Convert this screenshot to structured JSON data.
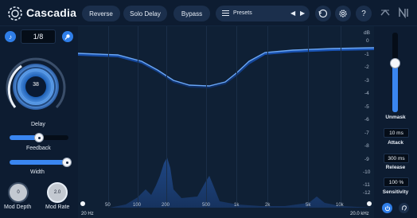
{
  "header": {
    "brand": "Cascadia",
    "reverse_label": "Reverse",
    "solo_delay_label": "Solo Delay",
    "bypass_label": "Bypass",
    "presets_label": "Presets"
  },
  "left_panel": {
    "sync_value": "1/8",
    "delay_knob_value": "38",
    "delay_label": "Delay",
    "feedback_label": "Feedback",
    "feedback_level": 0.5,
    "width_label": "Width",
    "width_level": 1.0,
    "mod_depth_value": "0",
    "mod_depth_label": "Mod Depth",
    "mod_rate_value": "2.0",
    "mod_rate_label": "Mod Rate"
  },
  "display": {
    "db_unit": "dB",
    "db_ticks": [
      "0",
      "-1",
      "-2",
      "-3",
      "-4",
      "-5",
      "-6",
      "-7",
      "-8",
      "-9",
      "-10",
      "-11",
      "-12"
    ],
    "freq_ticks": [
      "50",
      "100",
      "200",
      "500",
      "1k",
      "2k",
      "5k",
      "10k"
    ],
    "freq_min": "20 Hz",
    "freq_max": "20.0 kHz"
  },
  "right_panel": {
    "unmask_label": "Unmask",
    "unmask_level": 0.62,
    "attack_value": "10 ms",
    "attack_label": "Attack",
    "release_value": "300 ms",
    "release_label": "Release",
    "sensitivity_value": "100 %",
    "sensitivity_label": "Sensitivity"
  },
  "colors": {
    "accent": "#3a86f0",
    "background": "#0b1a2e",
    "button": "#1b2f4c"
  }
}
